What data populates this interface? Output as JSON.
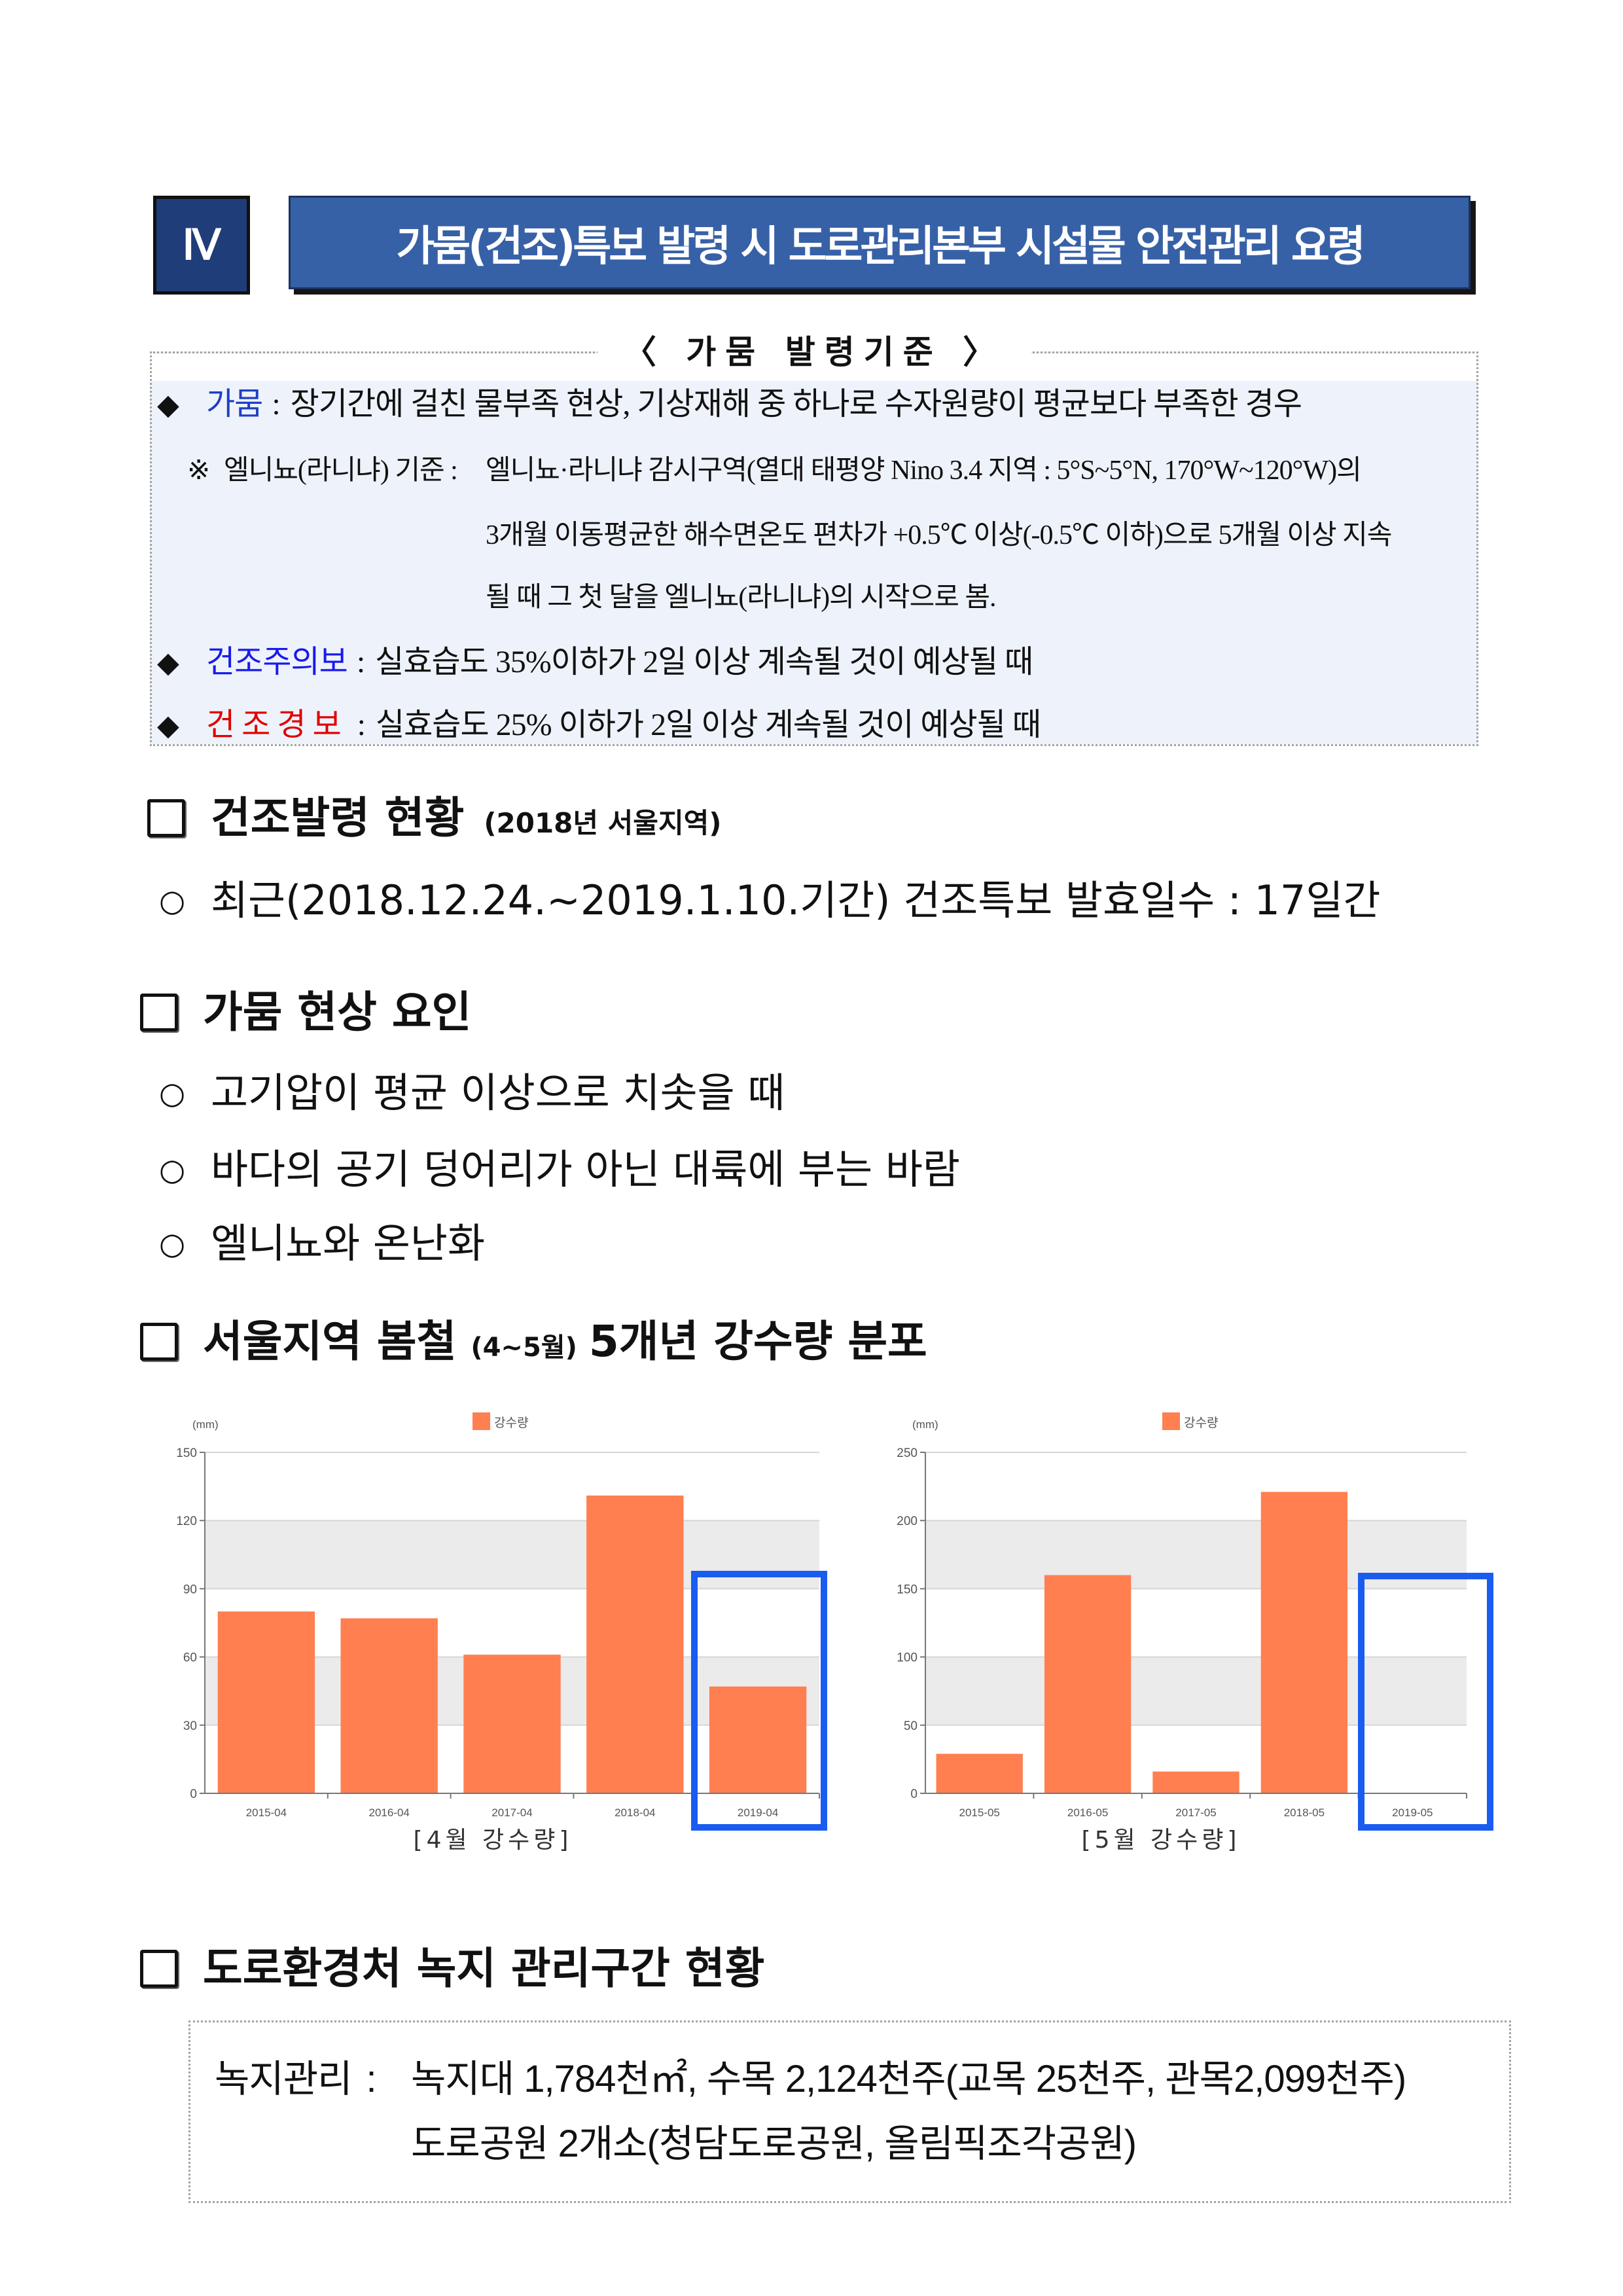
{
  "header": {
    "section_number": "Ⅳ",
    "title": "가뭄(건조)특보 발령 시 도로관리본부 시설물 안전관리 요령"
  },
  "criteria": {
    "title": "〈 가뭄 발령기준 〉",
    "bullet_symbol": "◆",
    "separator": ":",
    "drought": {
      "term": "가뭄",
      "desc": "장기간에 걸친 물부족 현상, 기상재해 중 하나로 수자원량이 평균보다 부족한 경우",
      "color": "#1f3fc4"
    },
    "el_nino_note": {
      "mark": "※",
      "label": "엘니뇨(라니냐) 기준 :",
      "lines": [
        "엘니뇨·라니냐 감시구역(열대 태평양 Nino 3.4 지역 : 5°S~5°N, 170°W~120°W)의",
        "3개월 이동평균한 해수면온도 편차가 +0.5℃ 이상(-0.5℃ 이하)으로 5개월 이상 지속",
        "될 때 그 첫 달을 엘니뇨(라니냐)의 시작으로 봄."
      ]
    },
    "dry_advisory": {
      "term": "건조주의보",
      "desc": "실효습도 35%이하가 2일 이상 계속될 것이 예상될 때",
      "color": "#1a1aee"
    },
    "dry_warning": {
      "term": "건조경보",
      "desc": "실효습도 25% 이하가 2일 이상 계속될 것이 예상될 때",
      "color": "#e00000"
    }
  },
  "item_bullet": "○",
  "sections": {
    "dry_status": {
      "heading": "건조발령 현황",
      "sub": "(2018년 서울지역)",
      "items": [
        "최근(2018.12.24.~2019.1.10.기간) 건조특보 발효일수 : 17일간"
      ]
    },
    "drought_causes": {
      "heading": "가뭄 현상 요인",
      "items": [
        "고기압이 평균 이상으로 치솟을 때",
        "바다의 공기 덩어리가 아닌 대륙에 부는 바람",
        "엘니뇨와 온난화"
      ]
    },
    "precipitation": {
      "heading_a": "서울지역 봄철",
      "heading_small": "(4~5월)",
      "heading_b": "5개년 강수량 분포"
    },
    "green_area": {
      "heading": "도로환경처 녹지 관리구간 현황",
      "label": "녹지관리",
      "sep": ":",
      "lines": [
        "녹지대 1,784천㎡, 수목 2,124천주(교목 25천주, 관목2,099천주)",
        "도로공원 2개소(청담도로공원, 올림픽조각공원)"
      ]
    }
  },
  "chart_data": [
    {
      "type": "bar",
      "unit_label": "(mm)",
      "categories": [
        "2015-04",
        "2016-04",
        "2017-04",
        "2018-04",
        "2019-04"
      ],
      "series": [
        {
          "name": "강수량",
          "values": [
            80,
            77,
            61,
            131,
            47
          ]
        }
      ],
      "ylim": [
        0,
        150
      ],
      "yticks": [
        0,
        30,
        60,
        90,
        120,
        150
      ],
      "grid": "horizontal-banded",
      "legend_position": "top-center",
      "highlight_category": "2019-04",
      "caption": "[4월 강수량]",
      "colors": {
        "bar": "#ff7f50",
        "band": "#ebebeb",
        "grid": "#d6d6d6",
        "highlight": "#1a5cf0"
      }
    },
    {
      "type": "bar",
      "unit_label": "(mm)",
      "categories": [
        "2015-05",
        "2016-05",
        "2017-05",
        "2018-05",
        "2019-05"
      ],
      "series": [
        {
          "name": "강수량",
          "values": [
            29,
            160,
            16,
            221,
            null
          ]
        }
      ],
      "ylim": [
        0,
        250
      ],
      "yticks": [
        0,
        50,
        100,
        150,
        200,
        250
      ],
      "grid": "horizontal-banded",
      "legend_position": "top-center",
      "highlight_category": "2019-05",
      "caption": "[5월 강수량]",
      "colors": {
        "bar": "#ff7f50",
        "band": "#ebebeb",
        "grid": "#d6d6d6",
        "highlight": "#1a5cf0"
      }
    }
  ]
}
